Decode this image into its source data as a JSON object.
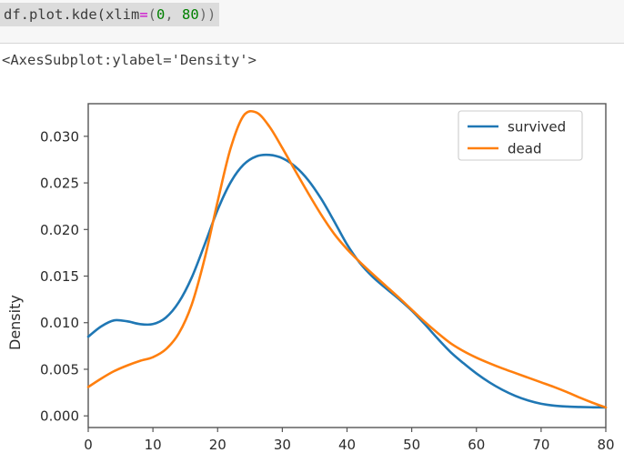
{
  "code_cell": {
    "prompt_text": "df.plot.kde(xlim=",
    "full_code": "df.plot.kde(xlim=(0, 80))",
    "segments": {
      "base": "df.plot.kde(xlim",
      "equals": "=",
      "open_parens": "(",
      "arg_zero": "0",
      "comma": ", ",
      "arg_eighty": "80",
      "close_parens": "))"
    },
    "colors": {
      "highlight_bg": "#dcdcdc",
      "cell_bg": "#f7f7f7",
      "text": "#3c3c3c",
      "operator": "#cc00cc",
      "number": "#008000"
    }
  },
  "output": {
    "repr_text": "<AxesSubplot:ylabel='Density'>"
  },
  "chart_data": {
    "type": "line",
    "title": "",
    "xlabel": "",
    "ylabel": "Density",
    "xlim": [
      0,
      80
    ],
    "ylim": [
      -0.00125,
      0.0335
    ],
    "xticks": [
      0,
      10,
      20,
      30,
      40,
      50,
      60,
      70,
      80
    ],
    "xticklabels": [
      "0",
      "10",
      "20",
      "30",
      "40",
      "50",
      "60",
      "70",
      "80"
    ],
    "yticks": [
      0.0,
      0.005,
      0.01,
      0.015,
      0.02,
      0.025,
      0.03
    ],
    "yticklabels": [
      "0.000",
      "0.005",
      "0.010",
      "0.015",
      "0.020",
      "0.025",
      "0.030"
    ],
    "grid": false,
    "legend_position": "upper right",
    "colors": {
      "survived": "#1f77b4",
      "dead": "#ff7f0e"
    },
    "x": [
      0,
      2,
      4,
      6,
      8,
      10,
      12,
      14,
      16,
      18,
      20,
      22,
      24,
      26,
      28,
      30,
      32,
      34,
      36,
      38,
      40,
      42,
      44,
      46,
      48,
      50,
      52,
      54,
      56,
      58,
      60,
      62,
      64,
      66,
      68,
      70,
      72,
      74,
      76,
      78,
      80
    ],
    "series": [
      {
        "name": "survived",
        "color": "#1f77b4",
        "values": [
          0.0085,
          0.0096,
          0.01025,
          0.01015,
          0.00985,
          0.00985,
          0.01055,
          0.0122,
          0.01485,
          0.0184,
          0.0221,
          0.02505,
          0.02695,
          0.02785,
          0.028,
          0.02765,
          0.02675,
          0.0253,
          0.0233,
          0.0209,
          0.0184,
          0.0164,
          0.0149,
          0.0137,
          0.01255,
          0.0113,
          0.00985,
          0.0083,
          0.00685,
          0.00565,
          0.00455,
          0.0036,
          0.0028,
          0.00215,
          0.00165,
          0.0013,
          0.0011,
          0.001,
          0.00095,
          0.00092,
          0.0009
        ]
      },
      {
        "name": "dead",
        "color": "#ff7f0e",
        "values": [
          0.0031,
          0.004,
          0.0048,
          0.0054,
          0.0059,
          0.0063,
          0.00715,
          0.00885,
          0.01195,
          0.0169,
          0.023,
          0.0287,
          0.0322,
          0.03255,
          0.03105,
          0.02875,
          0.0263,
          0.0239,
          0.0216,
          0.01955,
          0.0179,
          0.0165,
          0.0152,
          0.01395,
          0.0127,
          0.0114,
          0.0101,
          0.0089,
          0.0078,
          0.00695,
          0.00625,
          0.00565,
          0.0051,
          0.0046,
          0.0041,
          0.0036,
          0.0031,
          0.00255,
          0.00195,
          0.0014,
          0.0009
        ]
      }
    ]
  },
  "legend": {
    "entries": [
      {
        "label": "survived",
        "color": "#1f77b4"
      },
      {
        "label": "dead",
        "color": "#ff7f0e"
      }
    ]
  }
}
